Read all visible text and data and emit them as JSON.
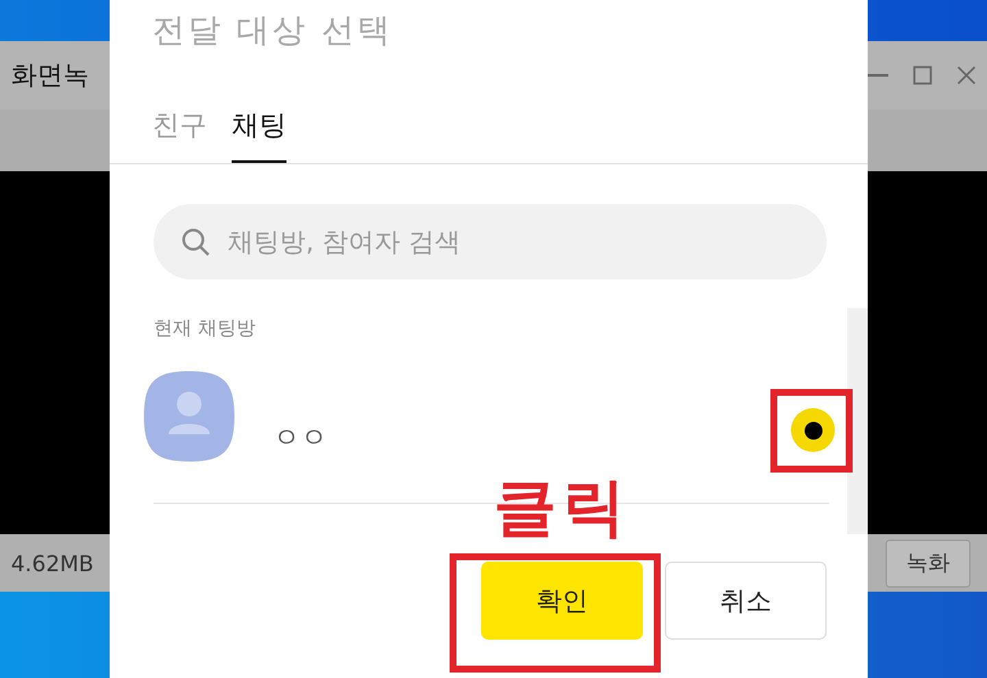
{
  "background_window": {
    "title": "화면녹",
    "file_size": "4.62MB",
    "record_button": "녹화"
  },
  "dialog": {
    "title": "전달 대상 선택",
    "tabs": [
      {
        "label": "친구",
        "selected": false
      },
      {
        "label": "채팅",
        "selected": true
      }
    ],
    "search": {
      "placeholder": "채팅방, 참여자 검색"
    },
    "section_label": "현재 채팅방",
    "chats": [
      {
        "name": "ㅇㅇ",
        "selected": true
      }
    ],
    "buttons": [
      {
        "label": "확인",
        "kind": "primary"
      },
      {
        "label": "취소",
        "kind": "secondary"
      }
    ]
  },
  "annotation": {
    "label": "클릭"
  }
}
